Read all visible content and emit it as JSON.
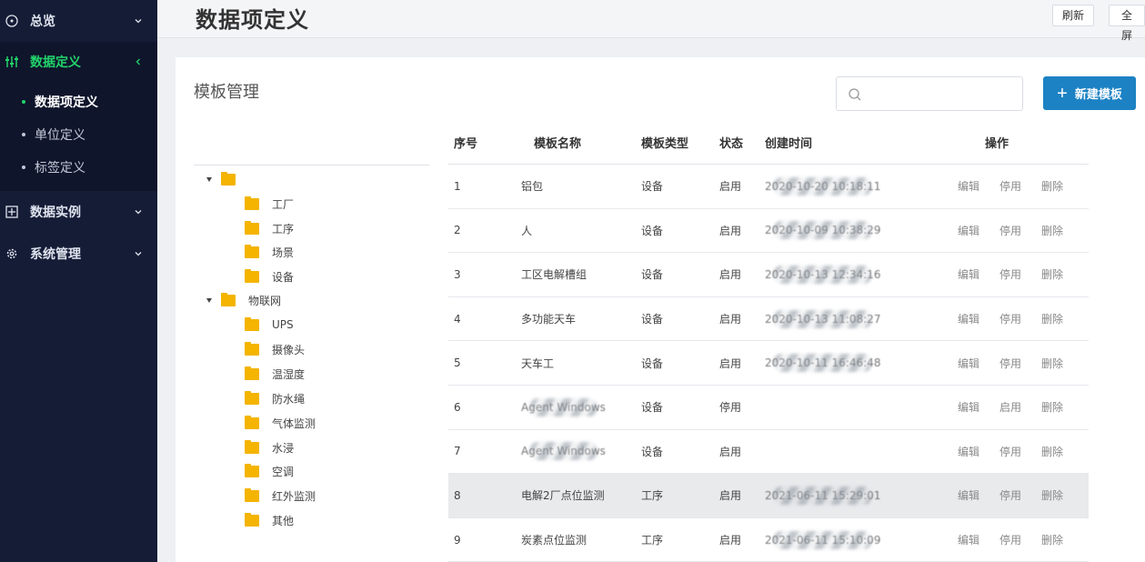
{
  "sidebar": {
    "items": [
      {
        "label": "总览"
      },
      {
        "label": "数据定义"
      },
      {
        "label": "数据实例"
      },
      {
        "label": "系统管理"
      }
    ],
    "submenu": [
      "数据项定义",
      "单位定义",
      "标签定义"
    ]
  },
  "header": {
    "title": "数据项定义",
    "refresh": "刷新",
    "fullscreen": "全屏"
  },
  "panel": {
    "title": "模板管理",
    "new_button": "新建模板"
  },
  "tree": {
    "root1_children": [
      "工厂",
      "工序",
      "场景",
      "设备"
    ],
    "root2_label": "物联网",
    "root2_children": [
      "UPS",
      "摄像头",
      "温湿度",
      "防水绳",
      "气体监测",
      "水浸",
      "空调",
      "红外监测",
      "其他"
    ]
  },
  "table": {
    "headers": {
      "idx": "序号",
      "name": "模板名称",
      "type": "模板类型",
      "status": "状态",
      "time": "创建时间",
      "ops": "操作"
    },
    "ops": {
      "edit": "编辑",
      "disable": "停用",
      "enable": "启用",
      "delete": "删除"
    },
    "rows": [
      {
        "idx": "1",
        "name": "铝包",
        "type": "设备",
        "status": "启用",
        "time": "2020-10-20 10:18:11",
        "toggle": "停用"
      },
      {
        "idx": "2",
        "name": "人",
        "type": "设备",
        "status": "启用",
        "time": "2020-10-09 10:38:29",
        "toggle": "停用"
      },
      {
        "idx": "3",
        "name": "工区电解槽组",
        "type": "设备",
        "status": "启用",
        "time": "2020-10-13 12:34:16",
        "toggle": "停用"
      },
      {
        "idx": "4",
        "name": "多功能天车",
        "type": "设备",
        "status": "启用",
        "time": "2020-10-13 11:08:27",
        "toggle": "停用"
      },
      {
        "idx": "5",
        "name": "天车工",
        "type": "设备",
        "status": "启用",
        "time": "2020-10-11 16:46:48",
        "toggle": "停用"
      },
      {
        "idx": "6",
        "name": "Agent Windows",
        "type": "设备",
        "status": "停用",
        "time": "",
        "toggle": "启用"
      },
      {
        "idx": "7",
        "name": "Agent Windows",
        "type": "设备",
        "status": "启用",
        "time": "",
        "toggle": "停用"
      },
      {
        "idx": "8",
        "name": "电解2厂点位监测",
        "type": "工序",
        "status": "启用",
        "time": "2021-06-11 15:29:01",
        "toggle": "停用"
      },
      {
        "idx": "9",
        "name": "炭素点位监测",
        "type": "工序",
        "status": "启用",
        "time": "2021-06-11 15:10:09",
        "toggle": "停用"
      }
    ]
  },
  "colors": {
    "sidebar_bg": "#151c36",
    "accent": "#22d36b",
    "primary": "#1c82c4"
  },
  "icons": [
    "overview-icon",
    "sliders-icon",
    "instance-icon",
    "gear-icon",
    "chevron-down-icon",
    "chevron-left-icon",
    "search-icon",
    "plus-icon",
    "folder-icon",
    "caret-down-icon"
  ]
}
